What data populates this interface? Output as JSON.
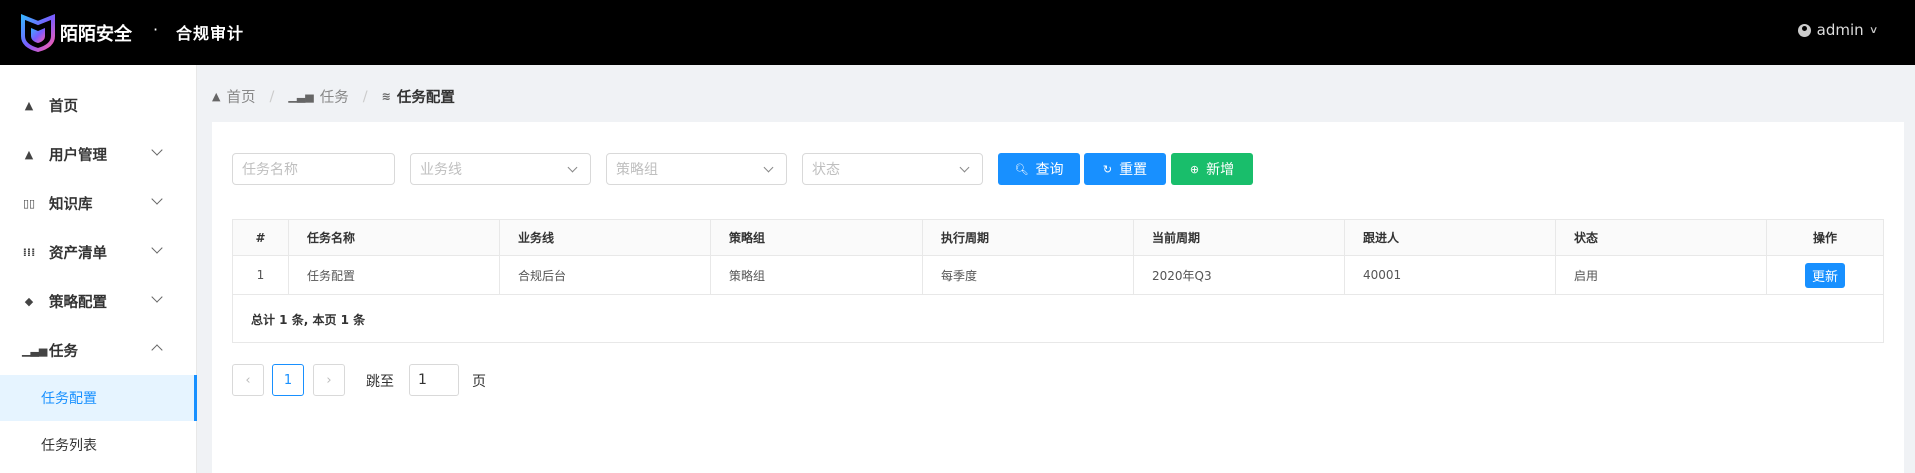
{
  "header": {
    "brand": "陌陌安全",
    "dot": "·",
    "subtitle": "合规审计",
    "user": "admin"
  },
  "sidebar": {
    "items": [
      {
        "label": "首页",
        "icon": "home-icon"
      },
      {
        "label": "用户管理",
        "icon": "home-icon"
      },
      {
        "label": "知识库",
        "icon": "book-icon"
      },
      {
        "label": "资产清单",
        "icon": "grid-icon"
      },
      {
        "label": "策略配置",
        "icon": "cube-icon"
      },
      {
        "label": "任务",
        "icon": "bar-chart-icon"
      }
    ],
    "subitems": [
      {
        "label": "任务配置",
        "active": true
      },
      {
        "label": "任务列表",
        "active": false
      }
    ]
  },
  "breadcrumb": {
    "home": "首页",
    "task": "任务",
    "current": "任务配置"
  },
  "filters": {
    "task_name_placeholder": "任务名称",
    "business_placeholder": "业务线",
    "policy_group_placeholder": "策略组",
    "status_placeholder": "状态"
  },
  "buttons": {
    "query": "查询",
    "reset": "重置",
    "add": "新增"
  },
  "table": {
    "headers": [
      "#",
      "任务名称",
      "业务线",
      "策略组",
      "执行周期",
      "当前周期",
      "跟进人",
      "状态",
      "操作"
    ],
    "rows": [
      [
        "1",
        "任务配置",
        "合规后台",
        "策略组",
        "每季度",
        "2020年Q3",
        "40001",
        "启用",
        "更新"
      ]
    ],
    "footer": "总计 1 条, 本页 1 条"
  },
  "pagination": {
    "prev": "‹",
    "current": "1",
    "next": "›",
    "jump_label": "跳至",
    "jump_value": "1",
    "page_suffix": "页"
  },
  "colors": {
    "primary": "#1890ff",
    "success": "#19be6b",
    "header_bg": "#000000"
  }
}
